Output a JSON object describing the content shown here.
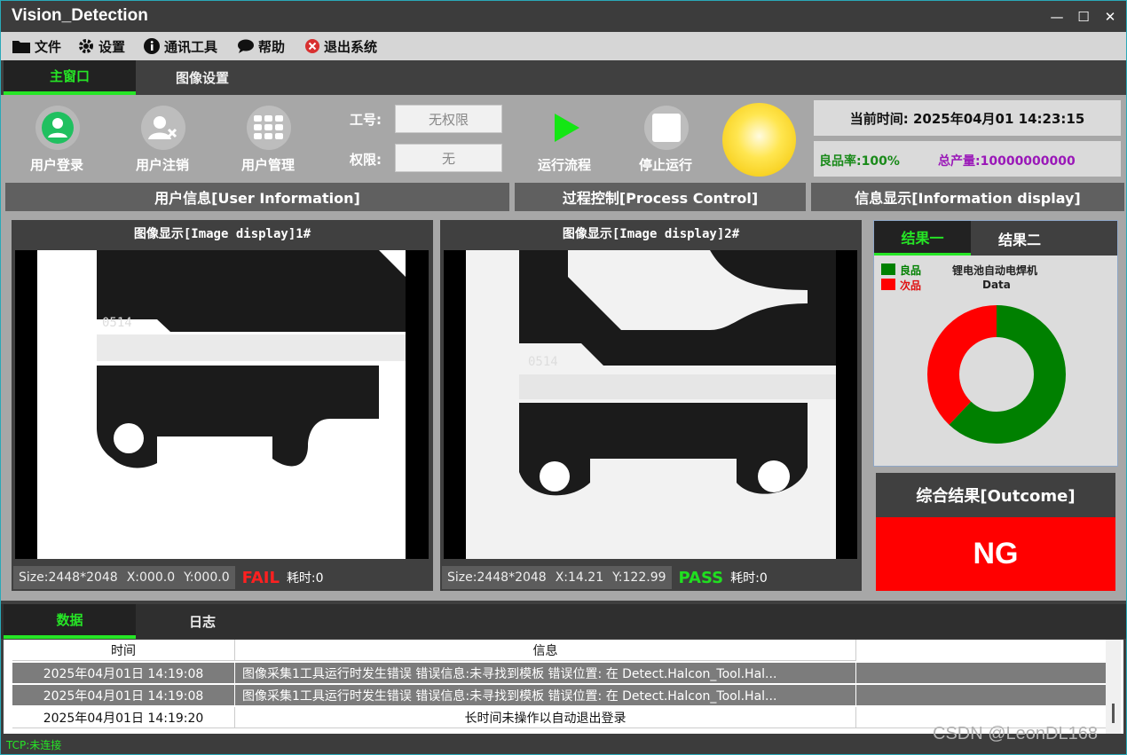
{
  "window": {
    "title": "Vision_Detection",
    "controls": [
      "—",
      "☐",
      "✕"
    ]
  },
  "menu": {
    "items": [
      {
        "label": "文件",
        "icon": "folder-icon"
      },
      {
        "label": "设置",
        "icon": "gear-icon"
      },
      {
        "label": "通讯工具",
        "icon": "info-icon"
      },
      {
        "label": "帮助",
        "icon": "chat-icon"
      },
      {
        "label": "退出系统",
        "icon": "exit-icon"
      }
    ]
  },
  "tabs": {
    "main": "主窗口",
    "image_settings": "图像设置"
  },
  "toolbar": {
    "login": "用户登录",
    "logout": "用户注销",
    "manage": "用户管理",
    "job_label": "工号:",
    "job_value": "无权限",
    "perm_label": "权限:",
    "perm_value": "无",
    "run": "运行流程",
    "stop": "停止运行"
  },
  "status_panel": {
    "time": "当前时间: 2025年04月01  14:23:15",
    "yield": "良品率:100%",
    "total": "总产量:10000000000"
  },
  "sections": {
    "user_info": "用户信息[User Information]",
    "process": "过程控制[Process Control]",
    "info_display": "信息显示[Information display]"
  },
  "image1": {
    "title": "图像显示[Image display]1#",
    "size": "Size:2448*2048",
    "x": "X:000.0",
    "y": "Y:000.0",
    "result": "FAIL",
    "time": "耗时:0"
  },
  "image2": {
    "title": "图像显示[Image display]2#",
    "size": "Size:2448*2048",
    "x": "X:14.21",
    "y": "Y:122.99",
    "result": "PASS",
    "time": "耗时:0"
  },
  "result_tabs": {
    "tab1": "结果一",
    "tab2": "结果二"
  },
  "donut": {
    "legend_good": "良品",
    "legend_bad": "次品",
    "title": "锂电池自动电焊机",
    "subtitle": "Data",
    "good_fraction": 0.62,
    "bad_fraction": 0.38,
    "good_color": "#008000",
    "bad_color": "#ff0000"
  },
  "outcome": {
    "title": "综合结果[Outcome]",
    "value": "NG",
    "value_color": "#ff0000"
  },
  "bottom_tabs": {
    "data": "数据",
    "log": "日志"
  },
  "log_table": {
    "headers": [
      "时间",
      "信息"
    ],
    "rows": [
      {
        "time": "2025年04月01日 14:19:08",
        "info": "图像采集1工具运行时发生错误 错误信息:未寻找到模板 错误位置:   在 Detect.Halcon_Tool.Hal..."
      },
      {
        "time": "2025年04月01日 14:19:08",
        "info": "图像采集1工具运行时发生错误 错误信息:未寻找到模板 错误位置:   在 Detect.Halcon_Tool.Hal..."
      },
      {
        "time": "2025年04月01日 14:19:20",
        "info": "长时间未操作以自动退出登录"
      }
    ]
  },
  "statusbar": {
    "text": "TCP:未连接"
  },
  "watermark": "CSDN @LeonDL168"
}
